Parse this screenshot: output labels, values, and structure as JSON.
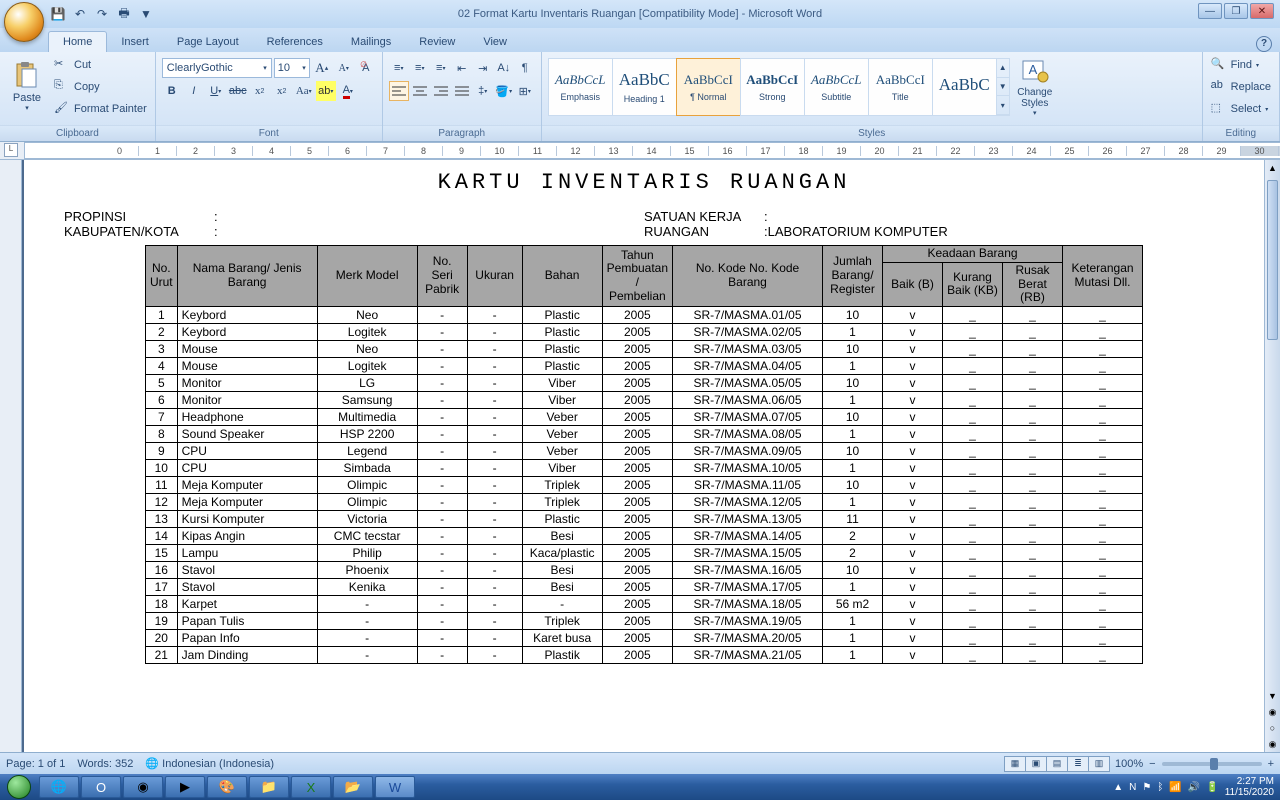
{
  "window": {
    "title": "02 Format Kartu Inventaris Ruangan [Compatibility Mode] - Microsoft Word"
  },
  "tabs": {
    "home": "Home",
    "insert": "Insert",
    "pagelayout": "Page Layout",
    "references": "References",
    "mailings": "Mailings",
    "review": "Review",
    "view": "View"
  },
  "ribbon": {
    "clipboard": {
      "label": "Clipboard",
      "paste": "Paste",
      "cut": "Cut",
      "copy": "Copy",
      "format_painter": "Format Painter"
    },
    "font": {
      "label": "Font",
      "name": "ClearlyGothic",
      "size": "10"
    },
    "paragraph": {
      "label": "Paragraph"
    },
    "styles": {
      "label": "Styles",
      "items": [
        {
          "preview": "AaBbCcL",
          "name": "Emphasis",
          "em": true
        },
        {
          "preview": "AaBbC",
          "name": "Heading 1",
          "big": true
        },
        {
          "preview": "AaBbCcI",
          "name": "¶ Normal",
          "active": true
        },
        {
          "preview": "AaBbCcI",
          "name": "Strong",
          "bold": true
        },
        {
          "preview": "AaBbCcL",
          "name": "Subtitle",
          "em": true
        },
        {
          "preview": "AaBbCcI",
          "name": "Title"
        },
        {
          "preview": "AaBbC",
          "name": "",
          "big": true
        }
      ],
      "change": "Change Styles"
    },
    "editing": {
      "label": "Editing",
      "find": "Find",
      "replace": "Replace",
      "select": "Select"
    }
  },
  "document": {
    "title": "KARTU INVENTARIS RUANGAN",
    "header": {
      "propinsi_label": "PROPINSI",
      "propinsi_val": "",
      "kabkota_label": "KABUPATEN/KOTA",
      "kabkota_val": "",
      "satuan_label": "SATUAN KERJA",
      "satuan_val": "",
      "ruangan_label": "RUANGAN",
      "ruangan_val": "LABORATORIUM KOMPUTER"
    },
    "columns": {
      "no": "No. Urut",
      "nama": "Nama Barang/ Jenis Barang",
      "merk": "Merk Model",
      "noseri": "No. Seri Pabrik",
      "ukuran": "Ukuran",
      "bahan": "Bahan",
      "tahun": "Tahun Pembuatan / Pembelian",
      "kode": "No. Kode\nNo. Kode Barang",
      "jumlah": "Jumlah Barang/ Register",
      "keadaan": "Keadaan Barang",
      "baik": "Baik (B)",
      "kb": "Kurang Baik (KB)",
      "rb": "Rusak Berat (RB)",
      "mutasi": "Keterangan Mutasi Dll."
    },
    "rows": [
      {
        "no": 1,
        "nama": "Keybord",
        "merk": "Neo",
        "seri": "-",
        "uk": "-",
        "bahan": "Plastic",
        "th": "2005",
        "kode": "SR-7/MASMA.01/05",
        "jml": "10",
        "b": "v",
        "kb": "_",
        "rb": "_",
        "mut": "_"
      },
      {
        "no": 2,
        "nama": "Keybord",
        "merk": "Logitek",
        "seri": "-",
        "uk": "-",
        "bahan": "Plastic",
        "th": "2005",
        "kode": "SR-7/MASMA.02/05",
        "jml": "1",
        "b": "v",
        "kb": "_",
        "rb": "_",
        "mut": "_"
      },
      {
        "no": 3,
        "nama": "Mouse",
        "merk": "Neo",
        "seri": "-",
        "uk": "-",
        "bahan": "Plastic",
        "th": "2005",
        "kode": "SR-7/MASMA.03/05",
        "jml": "10",
        "b": "v",
        "kb": "_",
        "rb": "_",
        "mut": "_"
      },
      {
        "no": 4,
        "nama": "Mouse",
        "merk": "Logitek",
        "seri": "-",
        "uk": "-",
        "bahan": "Plastic",
        "th": "2005",
        "kode": "SR-7/MASMA.04/05",
        "jml": "1",
        "b": "v",
        "kb": "_",
        "rb": "_",
        "mut": "_"
      },
      {
        "no": 5,
        "nama": "Monitor",
        "merk": "LG",
        "seri": "-",
        "uk": "-",
        "bahan": "Viber",
        "th": "2005",
        "kode": "SR-7/MASMA.05/05",
        "jml": "10",
        "b": "v",
        "kb": "_",
        "rb": "_",
        "mut": "_"
      },
      {
        "no": 6,
        "nama": "Monitor",
        "merk": "Samsung",
        "seri": "-",
        "uk": "-",
        "bahan": "Viber",
        "th": "2005",
        "kode": "SR-7/MASMA.06/05",
        "jml": "1",
        "b": "v",
        "kb": "_",
        "rb": "_",
        "mut": "_"
      },
      {
        "no": 7,
        "nama": "Headphone",
        "merk": "Multimedia",
        "seri": "-",
        "uk": "-",
        "bahan": "Veber",
        "th": "2005",
        "kode": "SR-7/MASMA.07/05",
        "jml": "10",
        "b": "v",
        "kb": "_",
        "rb": "_",
        "mut": "_"
      },
      {
        "no": 8,
        "nama": "Sound Speaker",
        "merk": "HSP 2200",
        "seri": "-",
        "uk": "-",
        "bahan": "Veber",
        "th": "2005",
        "kode": "SR-7/MASMA.08/05",
        "jml": "1",
        "b": "v",
        "kb": "_",
        "rb": "_",
        "mut": "_"
      },
      {
        "no": 9,
        "nama": "CPU",
        "merk": "Legend",
        "seri": "-",
        "uk": "-",
        "bahan": "Veber",
        "th": "2005",
        "kode": "SR-7/MASMA.09/05",
        "jml": "10",
        "b": "v",
        "kb": "_",
        "rb": "_",
        "mut": "_"
      },
      {
        "no": 10,
        "nama": "CPU",
        "merk": "Simbada",
        "seri": "-",
        "uk": "-",
        "bahan": "Viber",
        "th": "2005",
        "kode": "SR-7/MASMA.10/05",
        "jml": "1",
        "b": "v",
        "kb": "_",
        "rb": "_",
        "mut": "_"
      },
      {
        "no": 11,
        "nama": "Meja Komputer",
        "merk": "Olimpic",
        "seri": "-",
        "uk": "-",
        "bahan": "Triplek",
        "th": "2005",
        "kode": "SR-7/MASMA.11/05",
        "jml": "10",
        "b": "v",
        "kb": "_",
        "rb": "_",
        "mut": "_"
      },
      {
        "no": 12,
        "nama": "Meja Komputer",
        "merk": "Olimpic",
        "seri": "-",
        "uk": "-",
        "bahan": "Triplek",
        "th": "2005",
        "kode": "SR-7/MASMA.12/05",
        "jml": "1",
        "b": "v",
        "kb": "_",
        "rb": "_",
        "mut": "_"
      },
      {
        "no": 13,
        "nama": "Kursi Komputer",
        "merk": "Victoria",
        "seri": "-",
        "uk": "-",
        "bahan": "Plastic",
        "th": "2005",
        "kode": "SR-7/MASMA.13/05",
        "jml": "11",
        "b": "v",
        "kb": "_",
        "rb": "_",
        "mut": "_"
      },
      {
        "no": 14,
        "nama": "Kipas Angin",
        "merk": "CMC tecstar",
        "seri": "-",
        "uk": "-",
        "bahan": "Besi",
        "th": "2005",
        "kode": "SR-7/MASMA.14/05",
        "jml": "2",
        "b": "v",
        "kb": "_",
        "rb": "_",
        "mut": "_"
      },
      {
        "no": 15,
        "nama": "Lampu",
        "merk": "Philip",
        "seri": "-",
        "uk": "-",
        "bahan": "Kaca/plastic",
        "th": "2005",
        "kode": "SR-7/MASMA.15/05",
        "jml": "2",
        "b": "v",
        "kb": "_",
        "rb": "_",
        "mut": "_"
      },
      {
        "no": 16,
        "nama": "Stavol",
        "merk": "Phoenix",
        "seri": "-",
        "uk": "-",
        "bahan": "Besi",
        "th": "2005",
        "kode": "SR-7/MASMA.16/05",
        "jml": "10",
        "b": "v",
        "kb": "_",
        "rb": "_",
        "mut": "_"
      },
      {
        "no": 17,
        "nama": "Stavol",
        "merk": "Kenika",
        "seri": "-",
        "uk": "-",
        "bahan": "Besi",
        "th": "2005",
        "kode": "SR-7/MASMA.17/05",
        "jml": "1",
        "b": "v",
        "kb": "_",
        "rb": "_",
        "mut": "_"
      },
      {
        "no": 18,
        "nama": "Karpet",
        "merk": "-",
        "seri": "-",
        "uk": "-",
        "bahan": "-",
        "th": "2005",
        "kode": "SR-7/MASMA.18/05",
        "jml": "56 m2",
        "b": "v",
        "kb": "_",
        "rb": "_",
        "mut": "_"
      },
      {
        "no": 19,
        "nama": "Papan Tulis",
        "merk": "-",
        "seri": "-",
        "uk": "-",
        "bahan": "Triplek",
        "th": "2005",
        "kode": "SR-7/MASMA.19/05",
        "jml": "1",
        "b": "v",
        "kb": "_",
        "rb": "_",
        "mut": "_"
      },
      {
        "no": 20,
        "nama": "Papan Info",
        "merk": "-",
        "seri": "-",
        "uk": "-",
        "bahan": "Karet busa",
        "th": "2005",
        "kode": "SR-7/MASMA.20/05",
        "jml": "1",
        "b": "v",
        "kb": "_",
        "rb": "_",
        "mut": "_"
      },
      {
        "no": 21,
        "nama": "Jam Dinding",
        "merk": "-",
        "seri": "-",
        "uk": "-",
        "bahan": "Plastik",
        "th": "2005",
        "kode": "SR-7/MASMA.21/05",
        "jml": "1",
        "b": "v",
        "kb": "_",
        "rb": "_",
        "mut": "_"
      }
    ]
  },
  "statusbar": {
    "page": "Page: 1 of 1",
    "words": "Words: 352",
    "lang": "Indonesian (Indonesia)",
    "zoom": "100%"
  },
  "tray": {
    "time": "2:27 PM",
    "date": "11/15/2020"
  }
}
